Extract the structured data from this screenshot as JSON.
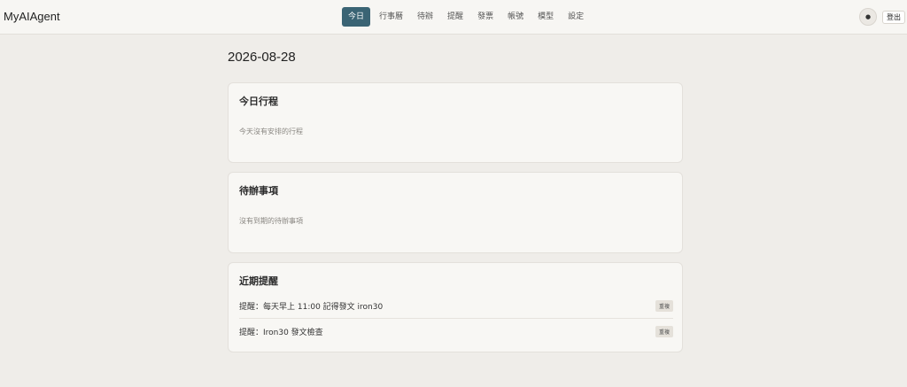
{
  "app": {
    "brand": "MyAIAgent"
  },
  "nav": {
    "items": [
      {
        "label": "今日"
      },
      {
        "label": "行事曆"
      },
      {
        "label": "待辦"
      },
      {
        "label": "提醒"
      },
      {
        "label": "發票"
      },
      {
        "label": "帳號"
      },
      {
        "label": "模型"
      },
      {
        "label": "設定"
      }
    ],
    "active": "今日"
  },
  "header": {
    "theme_toggle": "●",
    "logout_label": "登出"
  },
  "main": {
    "date": "2026-08-28",
    "schedule": {
      "title": "今日行程",
      "empty": "今天沒有安排的行程"
    },
    "todos": {
      "title": "待辦事項",
      "empty": "沒有到期的待辦事項"
    },
    "reminders": {
      "title": "近期提醒",
      "items": [
        {
          "text": "提醒：每天早上 11:00 記得發文 iron30",
          "tag": "重複"
        },
        {
          "text": "提醒：Iron30 發文檢查",
          "tag": "重複"
        }
      ]
    }
  },
  "colors": {
    "accent": "#3a6474",
    "background": "#efede9",
    "card": "#f8f7f4"
  }
}
